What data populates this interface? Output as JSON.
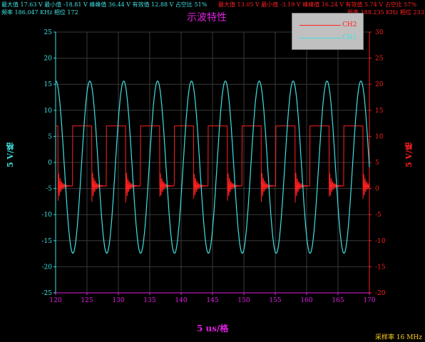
{
  "stats_ch1": {
    "line1": "最大值 17.63 V  最小值 -18.81 V  峰峰值 36.44  V 有效值 12.88 V  占空比 51%",
    "line2": "频率 186.047 KHz  相位 172"
  },
  "stats_ch2": {
    "line1": "最大值 13.05 V  最小值 -3.19 V  峰峰值 16.24  V 有效值 5.74 V  占空比 57%",
    "line2": "频率 188.235 KHz  相位 233"
  },
  "title": "示波特性",
  "ylabel_left": "5 V/格",
  "ylabel_right": "5 V/格",
  "xlabel": "5 us/格",
  "sample_rate": "采样率 16 MHz",
  "colors": {
    "ch1": "#40e0e0",
    "ch2": "#ff2020",
    "axis": "#e020e0",
    "grid": "#3a3a3a"
  },
  "legend": [
    {
      "name": "CH2",
      "color": "#ff2020"
    },
    {
      "name": "CH1",
      "color": "#40e0e0"
    }
  ],
  "chart_data": {
    "type": "line",
    "x_ticks": [
      120,
      125,
      130,
      135,
      140,
      145,
      150,
      155,
      160,
      165,
      170
    ],
    "y_left_ticks": [
      25,
      20,
      15,
      10,
      5,
      0,
      -5,
      -10,
      -15,
      -20,
      -25
    ],
    "y_right_ticks": [
      30,
      25,
      20,
      15,
      10,
      5,
      0,
      -5,
      -10,
      -15,
      -20
    ],
    "xlim": [
      120,
      170
    ],
    "ylim_left": [
      -25,
      25
    ],
    "ylim_right": [
      -20,
      30
    ],
    "grid": true,
    "series": [
      {
        "name": "CH1",
        "axis": "left",
        "shape": "sine",
        "amplitude": 16.5,
        "offset": -0.9,
        "period": 5.4,
        "phase_x": 124.1
      },
      {
        "name": "CH2",
        "axis": "right",
        "shape": "square",
        "high": 12.0,
        "low": 0.5,
        "period": 5.4,
        "rise_x": 122.7,
        "duty": 0.57
      }
    ]
  }
}
